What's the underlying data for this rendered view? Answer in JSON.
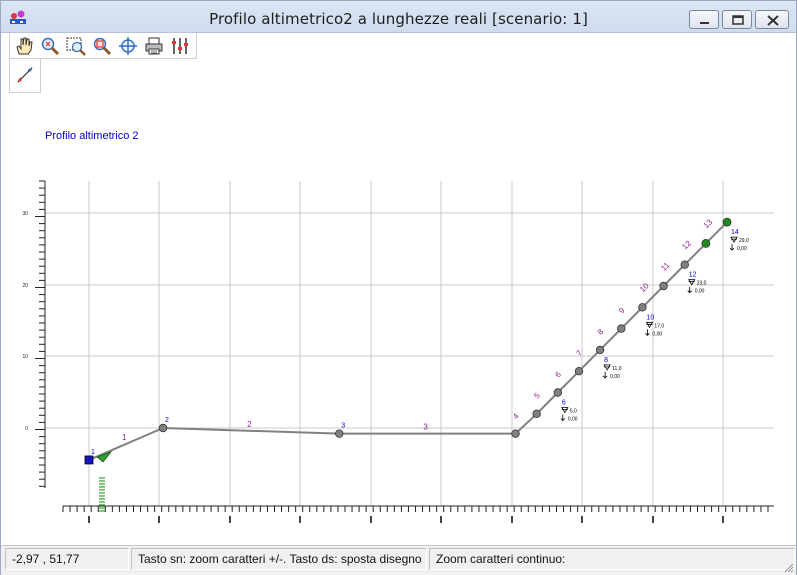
{
  "window": {
    "title": "Profilo altimetrico2 a lunghezze reali [scenario: 1]",
    "icons": [
      "app-icon",
      "minimize-icon",
      "maximize-icon",
      "close-icon"
    ]
  },
  "toolbar": {
    "tools": [
      {
        "name": "pan-hand-tool",
        "icon": "hand-icon"
      },
      {
        "name": "zoom-tool",
        "icon": "magnifier-icon"
      },
      {
        "name": "zoom-window-tool",
        "icon": "zoom-window-icon"
      },
      {
        "name": "zoom-extents-tool",
        "icon": "zoom-extents-icon"
      },
      {
        "name": "center-tool",
        "icon": "crosshair-icon"
      },
      {
        "name": "print-tool",
        "icon": "printer-icon"
      },
      {
        "name": "settings-tool",
        "icon": "sliders-icon"
      },
      {
        "name": "measure-tool",
        "icon": "measure-icon"
      }
    ]
  },
  "drawing": {
    "profile_title": "Profilo altimetrico 2",
    "colors": {
      "title": "#0000cc",
      "line": "#808080",
      "node": "#808080",
      "node_end": "#1e8c1e",
      "node_start": "#1414c8",
      "segment_label": "#8c1e8c",
      "node_label": "#0000cc"
    },
    "y_ticks": [
      "30",
      "20",
      "10",
      "0"
    ],
    "nodes": [
      {
        "id": "1",
        "x": 0,
        "z": -4.5,
        "style": "start"
      },
      {
        "id": "2",
        "x": 10.5,
        "z": 0
      },
      {
        "id": "3",
        "x": 35.5,
        "z": -0.8
      },
      {
        "id": "4",
        "x": 60.5,
        "z": -0.8
      },
      {
        "id": "5",
        "x": 63.5,
        "z": 2
      },
      {
        "id": "6",
        "x": 66.5,
        "z": 5
      },
      {
        "id": "7",
        "x": 69.5,
        "z": 8
      },
      {
        "id": "8",
        "x": 72.5,
        "z": 11
      },
      {
        "id": "9",
        "x": 75.5,
        "z": 14
      },
      {
        "id": "10",
        "x": 78.5,
        "z": 17
      },
      {
        "id": "11",
        "x": 81.5,
        "z": 20
      },
      {
        "id": "12",
        "x": 84.5,
        "z": 23
      },
      {
        "id": "13",
        "x": 87.5,
        "z": 26,
        "style": "end"
      },
      {
        "id": "14",
        "x": 90.5,
        "z": 29,
        "style": "end"
      }
    ],
    "segment_labels": [
      "1",
      "2",
      "3",
      "4",
      "5",
      "6",
      "7",
      "8",
      "9",
      "10",
      "11",
      "12",
      "13"
    ],
    "node_data": [
      {
        "node": "6",
        "level": "5,0",
        "depth": "0,00"
      },
      {
        "node": "8",
        "level": "11,0",
        "depth": "0,00"
      },
      {
        "node": "10",
        "level": "17,0",
        "depth": "0,00"
      },
      {
        "node": "12",
        "level": "23,0",
        "depth": "0,00"
      },
      {
        "node": "14",
        "level": "29,0",
        "depth": "0,00"
      }
    ]
  },
  "status": {
    "coords": "-2,97 , 51,77",
    "hint": "Tasto sn: zoom caratteri +/-. Tasto ds: sposta disegno",
    "zoom_mode": "Zoom caratteri continuo:"
  }
}
